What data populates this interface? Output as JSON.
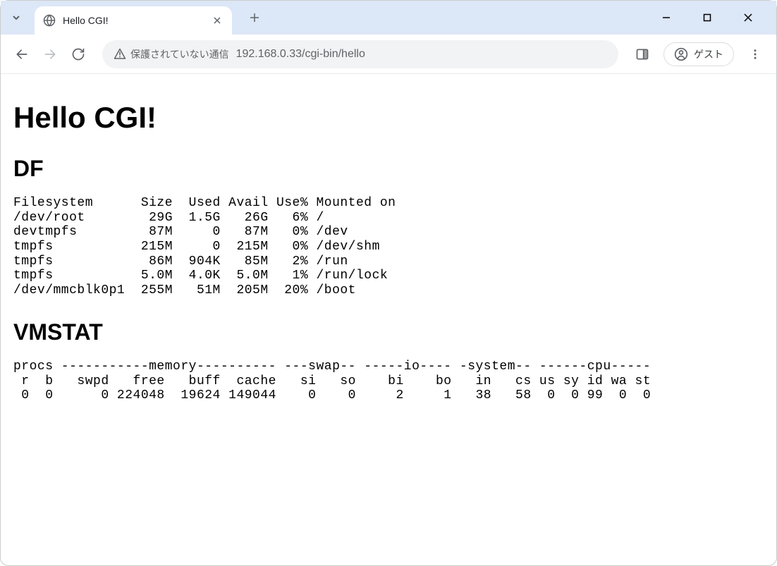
{
  "tab": {
    "title": "Hello CGI!"
  },
  "addressBar": {
    "securityText": "保護されていない通信",
    "url": "192.168.0.33/cgi-bin/hello"
  },
  "guestLabel": "ゲスト",
  "page": {
    "heading": "Hello CGI!",
    "sections": {
      "df": {
        "title": "DF",
        "output": "Filesystem      Size  Used Avail Use% Mounted on\n/dev/root        29G  1.5G   26G   6% /\ndevtmpfs         87M     0   87M   0% /dev\ntmpfs           215M     0  215M   0% /dev/shm\ntmpfs            86M  904K   85M   2% /run\ntmpfs           5.0M  4.0K  5.0M   1% /run/lock\n/dev/mmcblk0p1  255M   51M  205M  20% /boot"
      },
      "vmstat": {
        "title": "VMSTAT",
        "output": "procs -----------memory---------- ---swap-- -----io---- -system-- ------cpu-----\n r  b   swpd   free   buff  cache   si   so    bi    bo   in   cs us sy id wa st\n 0  0      0 224048  19624 149044    0    0     2     1   38   58  0  0 99  0  0"
      }
    }
  }
}
